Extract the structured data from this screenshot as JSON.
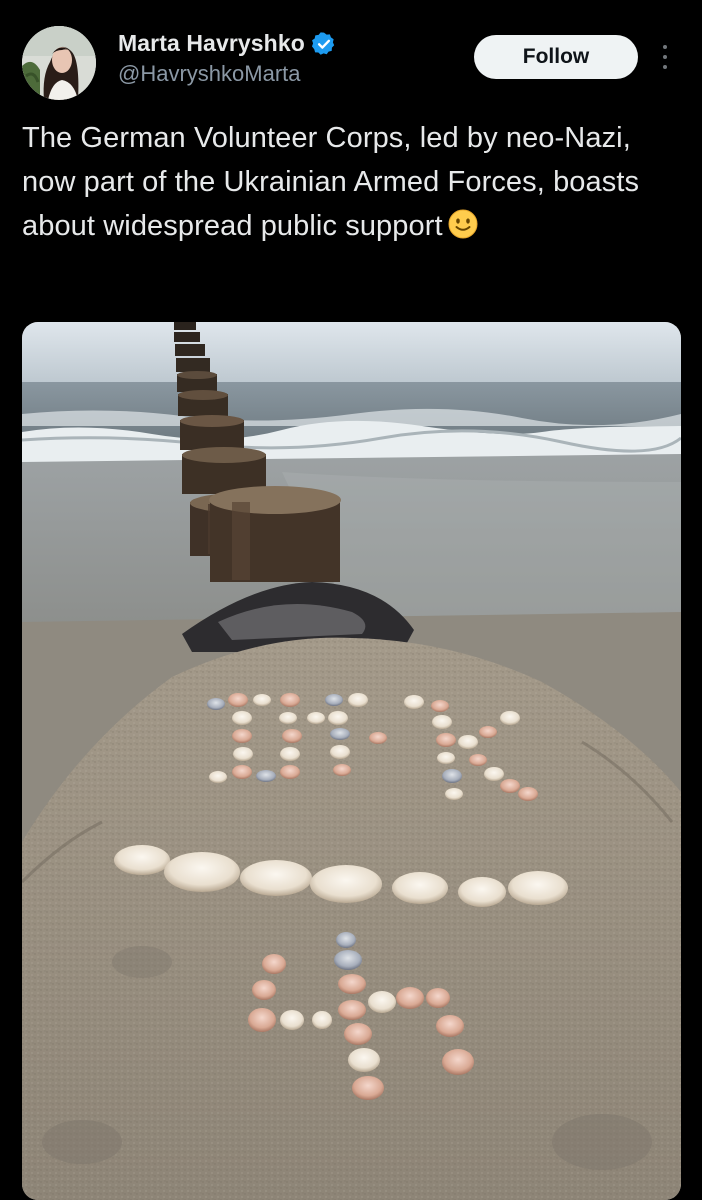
{
  "post": {
    "author": {
      "display_name": "Marta Havryshko",
      "handle": "@HavryshkoMarta",
      "verified": true,
      "avatar_icon": "avatar-photo"
    },
    "follow_label": "Follow",
    "more_icon": "more-vertical-icon",
    "text": "The German Volunteer Corps, led by neo-Nazi, now part of the Ukrainian Armed Forces, boasts about widespread public support",
    "emoji": "slightly-smiling-face",
    "media": {
      "kind": "photo",
      "scene": "shells-on-sand-beach"
    }
  },
  "colors": {
    "background": "#000000",
    "text_primary": "#e7e9ea",
    "text_secondary": "#8b98a5",
    "verified_blue": "#1d9bf0",
    "button_bg": "#eff3f4"
  }
}
